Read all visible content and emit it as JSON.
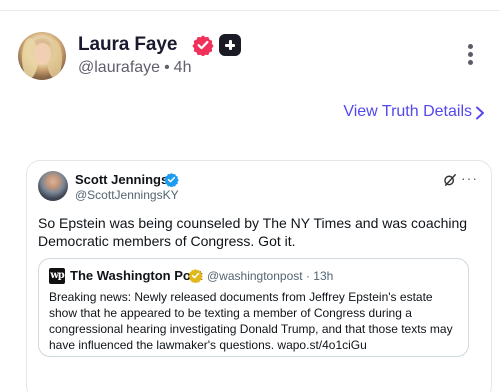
{
  "post": {
    "display_name": "Laura Faye",
    "handle": "@laurafaye",
    "separator": "•",
    "time": "4h",
    "details_link": "View Truth Details"
  },
  "embedded_tweet": {
    "name": "Scott Jennings",
    "handle": "@ScottJenningsKY",
    "more": "···",
    "text": "So Epstein was being counseled by The NY Times and was coaching Democratic members of Congress. Got it.",
    "quote": {
      "logo_text": "wp",
      "name": "The Washington Post",
      "handle": "@washingtonpost",
      "separator": "·",
      "time": "13h",
      "text": "Breaking news: Newly released documents from Jeffrey Epstein's estate show that he appeared to be texting a member of Congress during a congressional hearing investigating Donald Trump, and that those texts may have influenced the lawmaker's questions. wapo.st/4o1ciGu"
    }
  },
  "colors": {
    "accent": "#5448ee",
    "verified_red": "#f0325a",
    "verified_blue": "#1d9bf0",
    "gold_badge": "#e2b719"
  },
  "icons": {
    "post_verified": "verified-check-icon",
    "plus": "plus-badge-icon",
    "more": "more-vertical-icon",
    "chevron": "chevron-right-icon",
    "tweet_verified": "verified-check-icon",
    "grok": "grok-icon",
    "quote_badge": "gold-verified-icon"
  }
}
